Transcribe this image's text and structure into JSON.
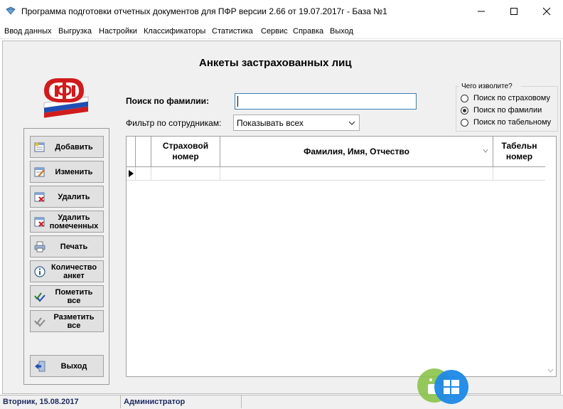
{
  "window": {
    "title": "Программа подготовки отчетных документов для ПФР версии 2.66 от 19.07.2017г - База №1",
    "controls": [
      "minimize-icon",
      "maximize-icon",
      "close-icon"
    ]
  },
  "menu": [
    "Ввод данных",
    "Выгрузка",
    "Настройки",
    "Классификаторы",
    "Статистика",
    "Сервис",
    "Справка",
    "Выход"
  ],
  "form": {
    "title": "Анкеты застрахованных лиц",
    "search_label": "Поиск по фамилии:",
    "search_value": "",
    "filter_label": "Фильтр по сотрудникам:",
    "filter_value": "Показывать всех"
  },
  "radio": {
    "title": "Чего изволите?",
    "options": [
      "Поиск по страховому",
      "Поиск по фамилии",
      "Поиск по табельному"
    ],
    "selected_index": 1
  },
  "buttons": [
    {
      "label": "Добавить",
      "icon": "add-record-icon"
    },
    {
      "label": "Изменить",
      "icon": "edit-record-icon"
    },
    {
      "label": "Удалить",
      "icon": "delete-record-icon"
    },
    {
      "label": "Удалить\nпомеченных",
      "icon": "delete-marked-icon"
    },
    {
      "label": "Печать",
      "icon": "printer-icon"
    },
    {
      "label": "Количество\nанкет",
      "icon": "info-icon"
    },
    {
      "label": "Пометить\nвсе",
      "icon": "check-all-icon"
    },
    {
      "label": "Разметить\nвсе",
      "icon": "uncheck-all-icon"
    },
    {
      "label": "Выход",
      "icon": "exit-door-icon"
    }
  ],
  "grid": {
    "columns": [
      "",
      "Страховой\nномер",
      "Фамилия, Имя, Отчество",
      "Табельн\nномер"
    ],
    "rows": [
      [
        "",
        "",
        "",
        ""
      ]
    ]
  },
  "status": {
    "date": "Вторник, 15.08.2017",
    "user": "Администратор"
  },
  "colors": {
    "accent_blue": "#3c7fb1",
    "status_text": "#1b2a5e",
    "logo_red": "#d01c1c"
  }
}
